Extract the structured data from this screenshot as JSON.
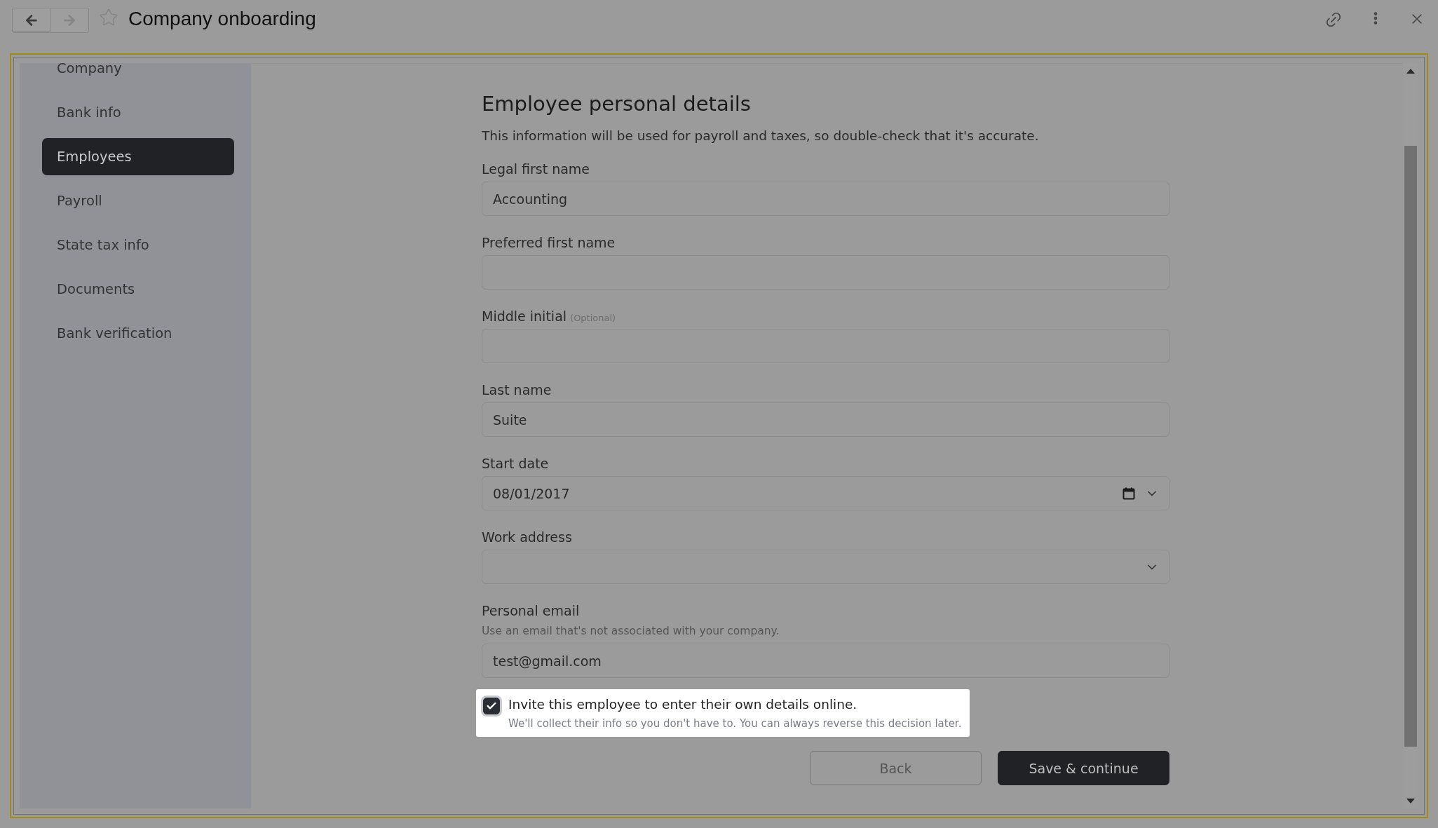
{
  "window": {
    "title": "Company onboarding",
    "starred": false,
    "nav": [
      {
        "kind": "back",
        "disabled": false
      },
      {
        "kind": "forward",
        "disabled": true
      }
    ]
  },
  "sidebar": {
    "items": [
      {
        "label": "Company",
        "selected": false
      },
      {
        "label": "Bank info",
        "selected": false
      },
      {
        "label": "Employees",
        "selected": true
      },
      {
        "label": "Payroll",
        "selected": false
      },
      {
        "label": "State tax info",
        "selected": false
      },
      {
        "label": "Documents",
        "selected": false
      },
      {
        "label": "Bank verification",
        "selected": false
      }
    ]
  },
  "form": {
    "heading": "Employee personal details",
    "description": "This information will be used for payroll and taxes, so double-check that it's accurate.",
    "fields": [
      {
        "kind": "text",
        "label": "Legal first name",
        "value": "Accounting"
      },
      {
        "kind": "text",
        "label": "Preferred first name"
      },
      {
        "kind": "text",
        "label": "Middle initial",
        "note": "(Optional)"
      },
      {
        "kind": "text",
        "label": "Last name",
        "value": "Suite"
      },
      {
        "kind": "date",
        "label": "Start date",
        "value": "08/01/2017"
      },
      {
        "kind": "select",
        "label": "Work address"
      },
      {
        "kind": "text",
        "label": "Personal email",
        "hint": "Use an email that's not associated with your company.",
        "value": "test@gmail.com"
      }
    ],
    "invite": {
      "checked": true,
      "highlighted": true,
      "label": "Invite this employee to enter their own details online.",
      "note": "We'll collect their info so you don't have to. You can always reverse this decision later."
    },
    "buttons": [
      {
        "kind": "secondary",
        "label": "Back"
      },
      {
        "kind": "primary",
        "label": "Save & continue"
      }
    ]
  }
}
